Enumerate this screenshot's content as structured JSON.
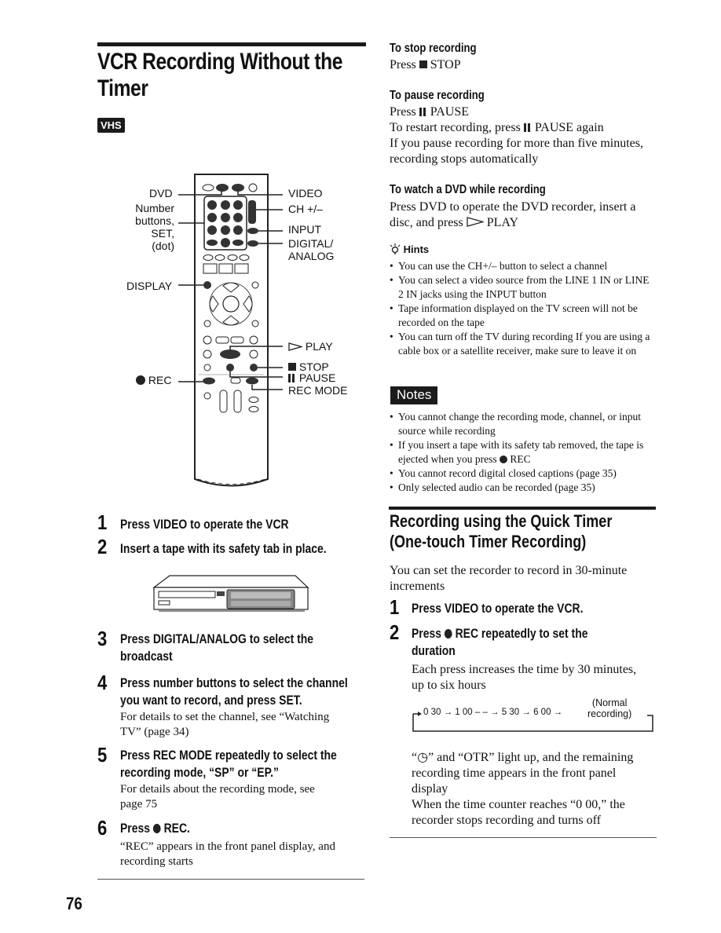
{
  "page": {
    "number": "76"
  },
  "left": {
    "title": "VCR Recording Without the Timer",
    "title_line1": "VCR Recording Without the",
    "title_line2": "Timer",
    "badge": "VHS",
    "remote_labels_left": {
      "dvd": "DVD",
      "number_buttons_1": "Number",
      "number_buttons_2": "buttons,",
      "number_buttons_3": "SET,",
      "number_buttons_4": "(dot)",
      "display": "DISPLAY",
      "rec": "REC"
    },
    "remote_labels_right": {
      "video": "VIDEO",
      "ch": "CH +/–",
      "input": "INPUT",
      "digital_analog_1": "DIGITAL/",
      "digital_analog_2": "ANALOG",
      "play": "PLAY",
      "stop": "STOP",
      "pause": "PAUSE",
      "rec_mode": "REC MODE"
    },
    "steps": [
      {
        "num": "1",
        "heading": "Press VIDEO to operate the VCR"
      },
      {
        "num": "2",
        "heading": "Insert a tape with its safety tab in place."
      },
      {
        "num": "3",
        "heading_l1": "Press DIGITAL/ANALOG to select the",
        "heading_l2": "broadcast"
      },
      {
        "num": "4",
        "heading_l1": "Press number buttons to select the channel",
        "heading_l2": "you want to record, and press SET.",
        "body_l1": "For details to set the channel, see “Watching",
        "body_l2": "TV” (page 34)"
      },
      {
        "num": "5",
        "heading_l1": "Press REC MODE repeatedly to select the",
        "heading_l2": "recording mode, “SP” or “EP.”",
        "body_l1": "For details about the recording mode, see",
        "body_l2": "page 75"
      },
      {
        "num": "6",
        "heading_pre": "Press",
        "heading_post": "REC.",
        "body_l1": "“REC” appears in the front panel display, and",
        "body_l2": "recording starts"
      }
    ]
  },
  "right": {
    "stop": {
      "heading": "To stop recording",
      "body_pre": "Press",
      "body_post": "STOP"
    },
    "pause": {
      "heading": "To pause recording",
      "line1_pre": "Press",
      "line1_post": "PAUSE",
      "line2_pre": "To restart recording, press",
      "line2_post": "PAUSE again",
      "line3": "If you pause recording for more than five minutes,",
      "line4": "recording stops automatically"
    },
    "dvd": {
      "heading": "To watch a DVD while recording",
      "line1": "Press DVD to operate the DVD recorder, insert a",
      "line2_pre": "disc, and press",
      "line2_post": "PLAY"
    },
    "hints": {
      "title": "Hints",
      "items": [
        "You can use the CH+/– button to select a channel",
        "You can select a video source from the LINE 1 IN or LINE 2 IN jacks using the INPUT button",
        "Tape information displayed on the TV screen will not be recorded on the tape",
        "You can turn off the TV during recording  If you are using a cable box or a satellite receiver, make sure to leave it on"
      ]
    },
    "notes": {
      "title": "Notes",
      "items": [
        "You cannot change the recording mode, channel, or input source while recording",
        "If you insert a tape with its safety tab removed, the tape is ejected when you press",
        "You cannot record digital closed captions (page 35)",
        "Only selected audio can be recorded (page 35)"
      ],
      "item2_suffix": "REC"
    },
    "quick_timer": {
      "title_l1": "Recording using the Quick Timer",
      "title_l2": "(One-touch Timer Recording)",
      "intro_l1": "You can set the recorder to record in 30-minute",
      "intro_l2": "increments",
      "step1": {
        "num": "1",
        "heading": "Press VIDEO to operate the VCR."
      },
      "step2": {
        "num": "2",
        "heading_pre": "Press",
        "heading_post": "REC repeatedly to set the",
        "heading_l2": "duration",
        "body_l1": "Each press increases the time by 30 minutes,",
        "body_l2": "up to six hours"
      },
      "sequence": [
        "0 30",
        "1 00",
        "5 30",
        "6 00"
      ],
      "sequence_end_l1": "(Normal",
      "sequence_end_l2": "recording)",
      "after_l1": "“◷” and “OTR” light up, and the remaining",
      "after_l2": "recording time appears in the front panel",
      "after_l3": "display",
      "after_l4": "When the time counter reaches “0 00,” the",
      "after_l5": "recorder stops recording and turns off"
    }
  }
}
